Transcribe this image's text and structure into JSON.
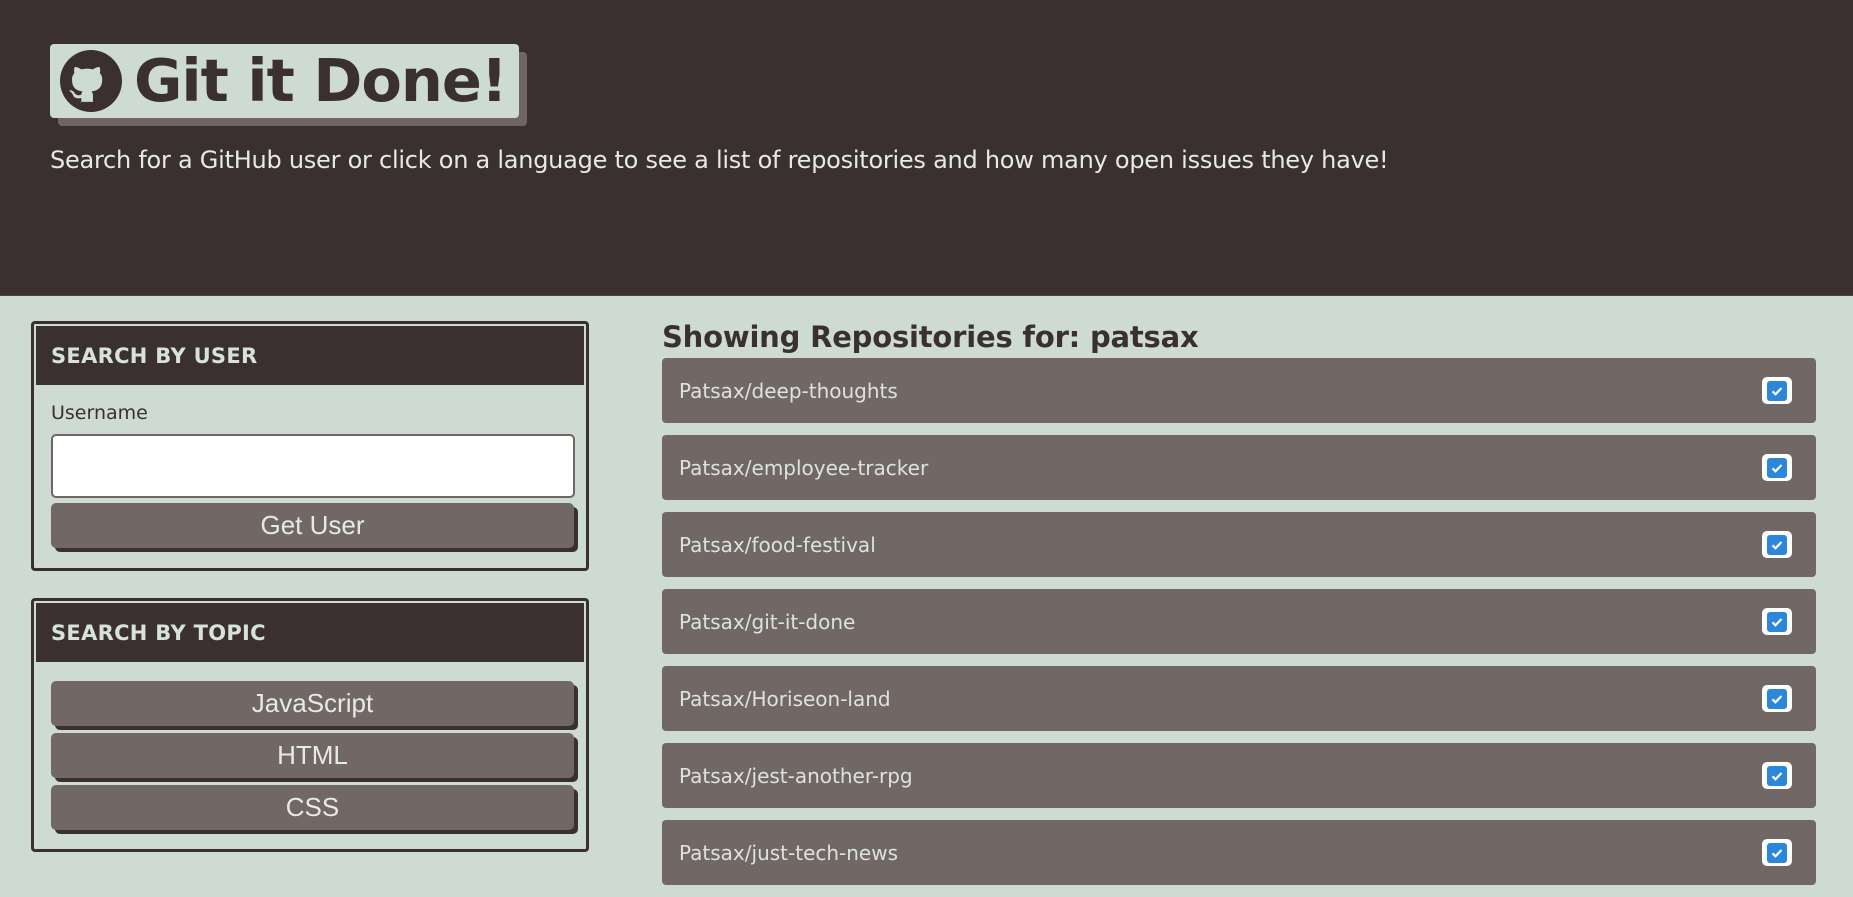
{
  "header": {
    "logo_text": "Git it Done!",
    "logo_icon": "github-icon",
    "subtitle": "Search for a GitHub user or click on a language to see a list of repositories and how many open issues they have!"
  },
  "user_search": {
    "heading": "SEARCH BY USER",
    "label": "Username",
    "input_value": "",
    "button_label": "Get User"
  },
  "topic_search": {
    "heading": "SEARCH BY TOPIC",
    "topics": [
      "JavaScript",
      "HTML",
      "CSS"
    ]
  },
  "repos": {
    "title": "Showing Repositories for: patsax",
    "items": [
      {
        "name": "Patsax/deep-thoughts",
        "status_icon": "checkmark-icon"
      },
      {
        "name": "Patsax/employee-tracker",
        "status_icon": "checkmark-icon"
      },
      {
        "name": "Patsax/food-festival",
        "status_icon": "checkmark-icon"
      },
      {
        "name": "Patsax/git-it-done",
        "status_icon": "checkmark-icon"
      },
      {
        "name": "Patsax/Horiseon-land",
        "status_icon": "checkmark-icon"
      },
      {
        "name": "Patsax/jest-another-rpg",
        "status_icon": "checkmark-icon"
      },
      {
        "name": "Patsax/just-tech-news",
        "status_icon": "checkmark-icon"
      }
    ]
  },
  "colors": {
    "background": "#cddbd3",
    "header_dark": "#3a302f",
    "item_gray": "#716866",
    "check_blue": "#2b87da"
  }
}
